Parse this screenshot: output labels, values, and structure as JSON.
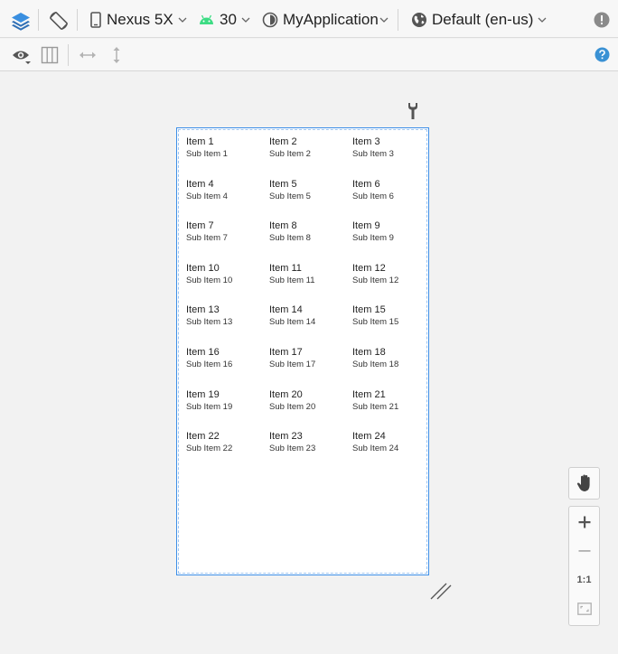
{
  "toolbar": {
    "device": "Nexus 5X",
    "api_level": "30",
    "theme": "MyApplication",
    "locale": "Default (en-us)"
  },
  "preview": {
    "items": [
      {
        "title": "Item 1",
        "subtitle": "Sub Item 1"
      },
      {
        "title": "Item 2",
        "subtitle": "Sub Item 2"
      },
      {
        "title": "Item 3",
        "subtitle": "Sub Item 3"
      },
      {
        "title": "Item 4",
        "subtitle": "Sub Item 4"
      },
      {
        "title": "Item 5",
        "subtitle": "Sub Item 5"
      },
      {
        "title": "Item 6",
        "subtitle": "Sub Item 6"
      },
      {
        "title": "Item 7",
        "subtitle": "Sub Item 7"
      },
      {
        "title": "Item 8",
        "subtitle": "Sub Item 8"
      },
      {
        "title": "Item 9",
        "subtitle": "Sub Item 9"
      },
      {
        "title": "Item 10",
        "subtitle": "Sub Item 10"
      },
      {
        "title": "Item 11",
        "subtitle": "Sub Item 11"
      },
      {
        "title": "Item 12",
        "subtitle": "Sub Item 12"
      },
      {
        "title": "Item 13",
        "subtitle": "Sub Item 13"
      },
      {
        "title": "Item 14",
        "subtitle": "Sub Item 14"
      },
      {
        "title": "Item 15",
        "subtitle": "Sub Item 15"
      },
      {
        "title": "Item 16",
        "subtitle": "Sub Item 16"
      },
      {
        "title": "Item 17",
        "subtitle": "Sub Item 17"
      },
      {
        "title": "Item 18",
        "subtitle": "Sub Item 18"
      },
      {
        "title": "Item 19",
        "subtitle": "Sub Item 19"
      },
      {
        "title": "Item 20",
        "subtitle": "Sub Item 20"
      },
      {
        "title": "Item 21",
        "subtitle": "Sub Item 21"
      },
      {
        "title": "Item 22",
        "subtitle": "Sub Item 22"
      },
      {
        "title": "Item 23",
        "subtitle": "Sub Item 23"
      },
      {
        "title": "Item 24",
        "subtitle": "Sub Item 24"
      }
    ]
  },
  "zoom": {
    "one_to_one_label": "1:1"
  },
  "colors": {
    "accent": "#3d8fe8",
    "android_green": "#3ddc84",
    "help_blue": "#3a91d4"
  },
  "icons": {
    "design_surface": "layers-icon",
    "orientation": "rotate-icon",
    "device": "phone-icon",
    "api": "android-icon",
    "theme": "theme-icon",
    "locale": "globe-icon",
    "warnings": "warning-icon",
    "visibility": "eye-icon",
    "blueprint": "columns-icon",
    "width": "horizontal-arrows-icon",
    "height": "vertical-arrows-icon",
    "help": "help-icon",
    "wrench": "wrench-icon",
    "resize": "resize-handle-icon",
    "pan": "hand-icon",
    "zoom_in": "plus-icon",
    "zoom_out": "minus-icon",
    "fit": "fit-screen-icon"
  }
}
